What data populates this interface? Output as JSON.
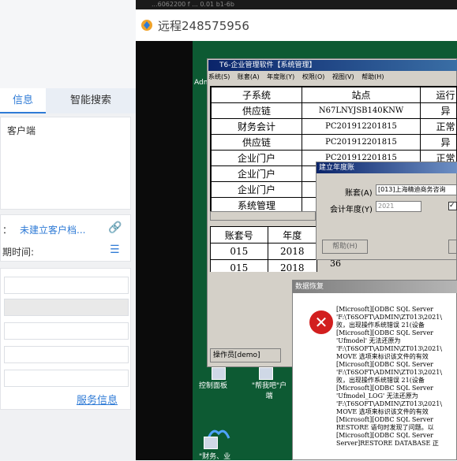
{
  "left_panel": {
    "tabs": [
      {
        "label": "信息"
      },
      {
        "label": "智能搜索"
      }
    ],
    "client_label": "客户端",
    "info_line1_label": "：",
    "info_line1_value": "未建立客户档...",
    "info_line2_label": "期时间:",
    "service_link": "服务信息"
  },
  "remote": {
    "title": "远程248575956",
    "top_overlay": "...6062200 f ... 0.01 b1-6b"
  },
  "t6": {
    "title": "T6-企业管理软件【系统管理】",
    "menu": [
      "系统(S)",
      "账套(A)",
      "年度账(Y)",
      "权限(O)",
      "视图(V)",
      "帮助(H)"
    ],
    "table_headers": [
      "子系统",
      "站点",
      "运行"
    ],
    "rows": [
      [
        "供应链",
        "N67LNYJSB140KNW",
        "异"
      ],
      [
        "财务会计",
        "PC201912201815",
        "正常"
      ],
      [
        "供应链",
        "PC201912201815",
        "异"
      ],
      [
        "企业门户",
        "PC201912201815",
        "正常"
      ],
      [
        "企业门户",
        "",
        ""
      ],
      [
        "企业门户",
        "",
        ""
      ],
      [
        "系统管理",
        "",
        ""
      ]
    ],
    "acct_headers": [
      "账套号",
      "年度"
    ],
    "acct_rows": [
      [
        "015",
        "2018"
      ],
      [
        "015",
        "2018"
      ]
    ],
    "acct_extra": "36",
    "status": "操作员[demo]"
  },
  "year_dialog": {
    "title": "建立年度账",
    "acct_label": "账套(A)",
    "acct_value": "[013]上海精迪商务咨询",
    "year_label": "会计年度(Y)",
    "year_value": "2021",
    "help": "帮助(H)"
  },
  "error_dialog": {
    "title": "数据恢复",
    "lines": [
      "[Microsoft][ODBC SQL Server",
      "'F:\\T6SOFT\\ADMIN\\ZT013\\2021\\",
      "败，出现操作系统错误 21(设备",
      "[Microsoft][ODBC SQL Server",
      "'Ufmodel' 无法还原为",
      "'F:\\T6SOFT\\ADMIN\\ZT013\\2021\\",
      "MOVE 选项来标识该文件的有效",
      "[Microsoft][ODBC SQL Server",
      "'F:\\T6SOFT\\ADMIN\\ZT013\\2021\\",
      "败，出现操作系统错误 21(设备",
      "[Microsoft][ODBC SQL Server",
      "'Ufmodel_LOG' 无法还原为",
      "'F:\\T6SOFT\\ADMIN\\ZT013\\2021\\",
      "MOVE 选项来标识该文件的有效",
      "[Microsoft][ODBC SQL Server",
      "RESTORE 语句时发现了问题。以",
      "[Microsoft][ODBC SQL Server",
      "Server]RESTORE DATABASE 正"
    ]
  },
  "desktop": {
    "icons": [
      {
        "label": "控制面板"
      },
      {
        "label": "\"帮我吧\"户端"
      },
      {
        "label": "\"财务、业"
      }
    ],
    "adm": "Adm"
  }
}
